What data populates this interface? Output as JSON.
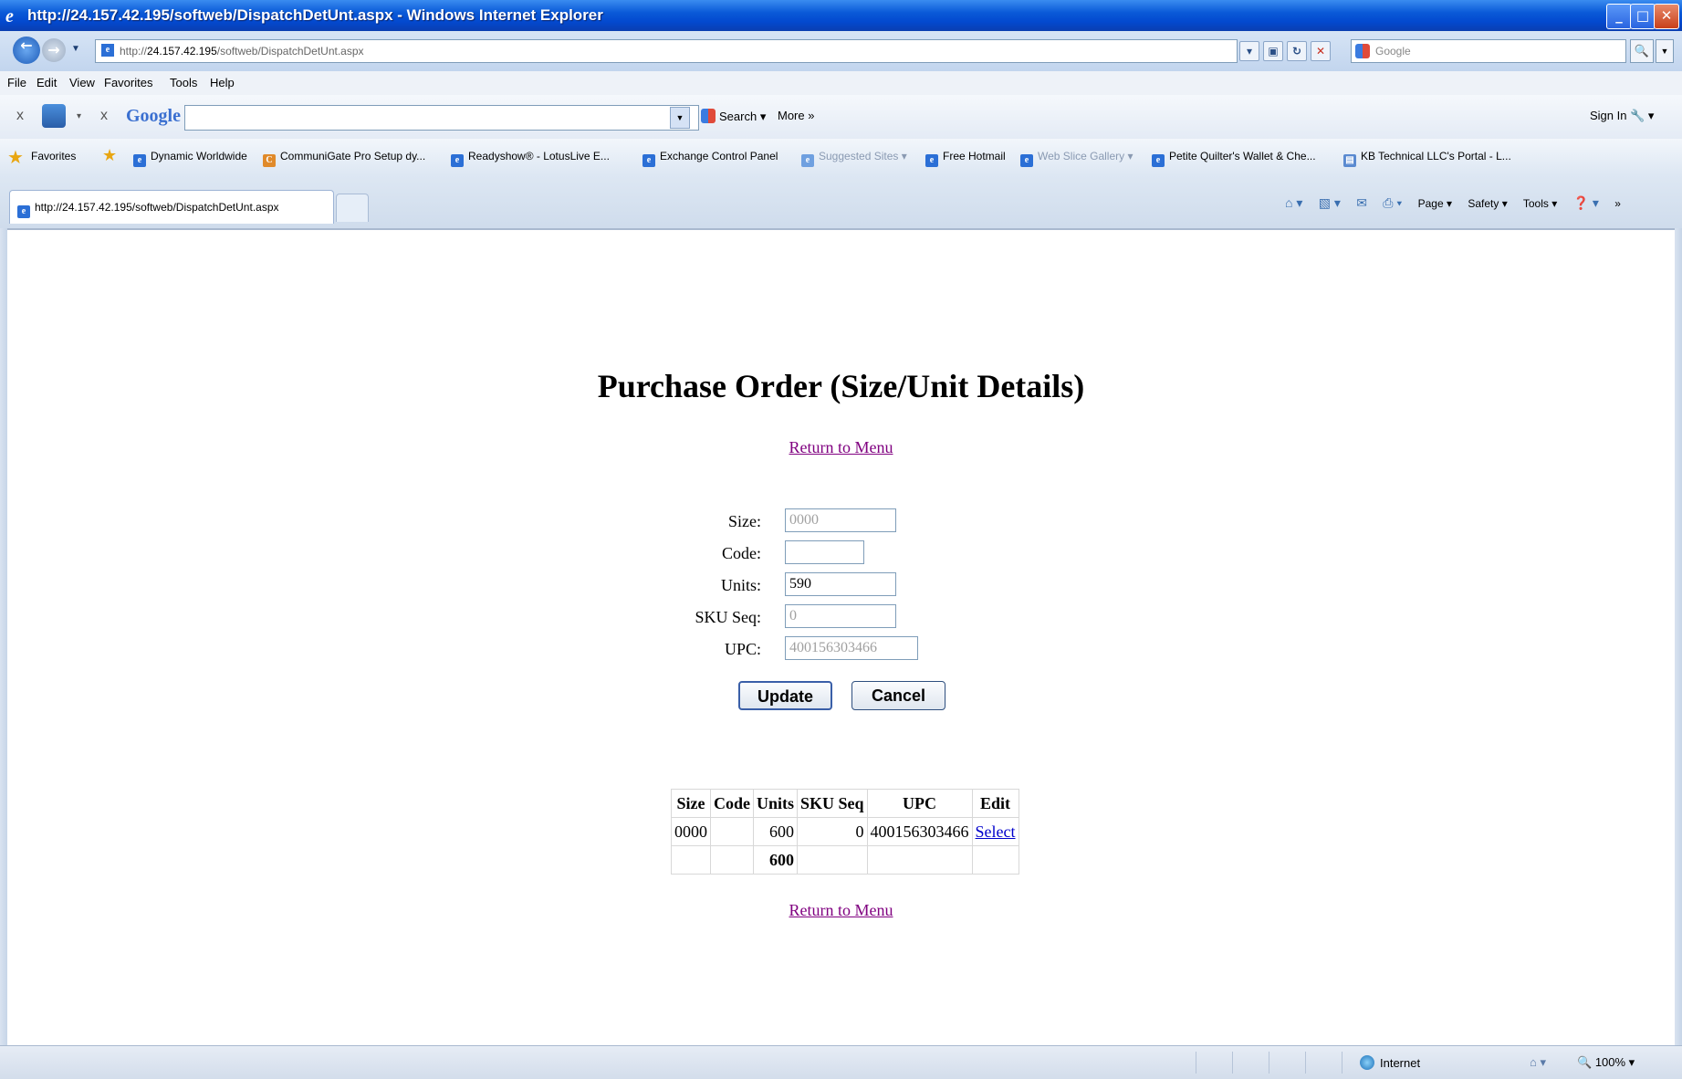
{
  "window": {
    "title": "http://24.157.42.195/softweb/DispatchDetUnt.aspx - Windows Internet Explorer"
  },
  "address_bar": {
    "url_prefix": "http://",
    "url_host": "24.157.42.195",
    "url_path": "/softweb/DispatchDetUnt.aspx",
    "search_placeholder": "Google"
  },
  "menu": [
    "File",
    "Edit",
    "View",
    "Favorites",
    "Tools",
    "Help"
  ],
  "google_toolbar": {
    "logo": "Google",
    "search_label": "Search",
    "more_label": "More »",
    "sign_in": "Sign In"
  },
  "favorites_bar": {
    "label": "Favorites",
    "items": [
      "Dynamic Worldwide",
      "CommuniGate Pro Setup dy...",
      "Readyshow® - LotusLive E...",
      "Exchange Control Panel",
      "Suggested Sites ▾",
      "Free Hotmail",
      "Web Slice Gallery ▾",
      "Petite Quilter's Wallet & Che...",
      "KB Technical LLC's Portal - L..."
    ]
  },
  "tab": {
    "title": "http://24.157.42.195/softweb/DispatchDetUnt.aspx"
  },
  "command_bar": {
    "page": "Page ▾",
    "safety": "Safety ▾",
    "tools": "Tools ▾"
  },
  "page": {
    "title": "Purchase Order (Size/Unit Details)",
    "return_link": "Return to Menu",
    "form": {
      "size_label": "Size:",
      "size_value": "0000",
      "code_label": "Code:",
      "code_value": "",
      "units_label": "Units:",
      "units_value": "590",
      "sku_label": "SKU Seq:",
      "sku_value": "0",
      "upc_label": "UPC:",
      "upc_value": "400156303466",
      "update_button": "Update",
      "cancel_button": "Cancel"
    },
    "table": {
      "headers": [
        "Size",
        "Code",
        "Units",
        "SKU Seq",
        "UPC",
        "Edit"
      ],
      "rows": [
        {
          "size": "0000",
          "code": "",
          "units": "600",
          "sku": "0",
          "upc": "400156303466",
          "edit": "Select"
        }
      ],
      "total_units": "600"
    }
  },
  "status_bar": {
    "zone": "Internet",
    "zoom": "100%"
  }
}
